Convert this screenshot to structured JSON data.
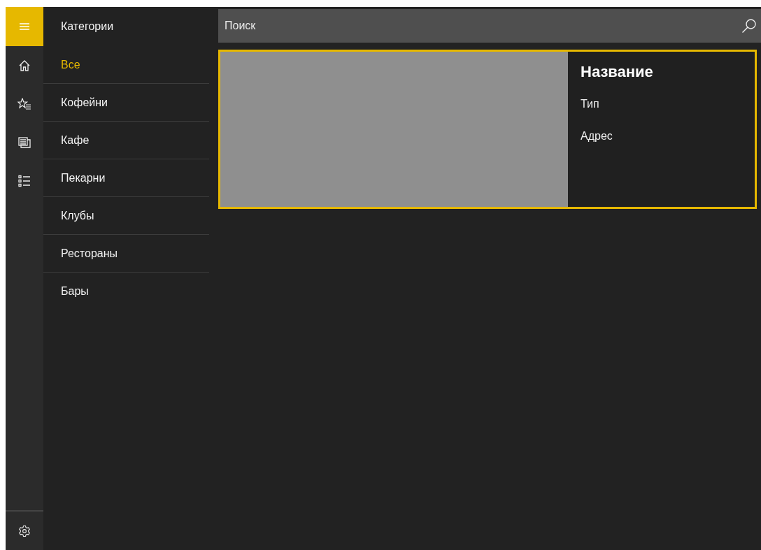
{
  "nav_rail": {
    "items": [
      {
        "kind": "home"
      },
      {
        "kind": "favorites"
      },
      {
        "kind": "news"
      },
      {
        "kind": "list"
      }
    ],
    "footer": {
      "kind": "settings"
    }
  },
  "categories": {
    "title": "Категории",
    "items": [
      {
        "label": "Все",
        "selected": true
      },
      {
        "label": "Кофейни",
        "selected": false
      },
      {
        "label": "Кафе",
        "selected": false
      },
      {
        "label": "Пекарни",
        "selected": false
      },
      {
        "label": "Клубы",
        "selected": false
      },
      {
        "label": "Рестораны",
        "selected": false
      },
      {
        "label": "Бары",
        "selected": false
      }
    ]
  },
  "search": {
    "placeholder": "Поиск"
  },
  "cards": [
    {
      "title": "Название",
      "type": "Тип",
      "address": "Адрес",
      "selected": true,
      "image": {
        "kind": "placeholder"
      }
    }
  ]
}
